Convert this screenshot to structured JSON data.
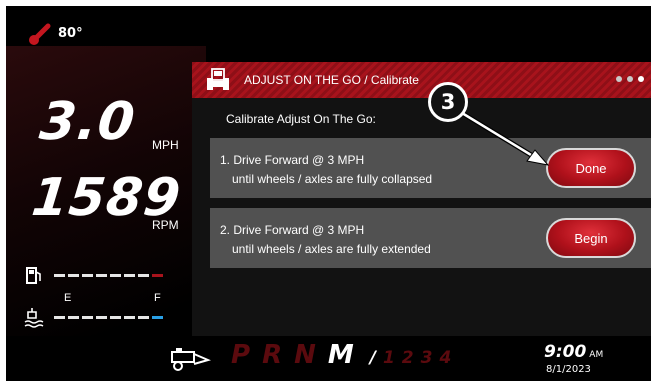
{
  "status": {
    "temperature": "80°"
  },
  "gauges": {
    "speed": {
      "value": "3.0",
      "unit": "MPH"
    },
    "rpm": {
      "value": "1589",
      "unit": "RPM"
    },
    "fuel": {
      "level_segments": 7,
      "total_segments": 8,
      "empty_label": "E",
      "full_label": "F"
    },
    "fluid": {
      "level_segments": 8,
      "total_segments": 8
    }
  },
  "panel": {
    "icon": "sprayer-vehicle-icon",
    "title": "ADJUST ON THE GO / Calibrate",
    "page_dots": 3,
    "active_dot": 3,
    "subtitle": "Calibrate Adjust On The Go:",
    "steps": [
      {
        "line1": "1. Drive Forward @ 3 MPH",
        "line2": "until wheels / axles are fully collapsed",
        "button": "Done"
      },
      {
        "line1": "2. Drive Forward @ 3 MPH",
        "line2": "until wheels / axles are fully extended",
        "button": "Begin"
      }
    ]
  },
  "callout": {
    "number": "3"
  },
  "bottom": {
    "gears": [
      "P",
      "R",
      "N",
      "M"
    ],
    "active_gear": "M",
    "ranges": [
      "/",
      "1",
      "2",
      "3",
      "4"
    ],
    "active_range": "/",
    "time": "9:00",
    "ampm": "AM",
    "date": "8/1/2023"
  },
  "colors": {
    "accent": "#a8131c",
    "button_red": "#b0111b",
    "inactive_gear": "#5b0a0e",
    "fluid_marker": "#2aa0e6"
  }
}
